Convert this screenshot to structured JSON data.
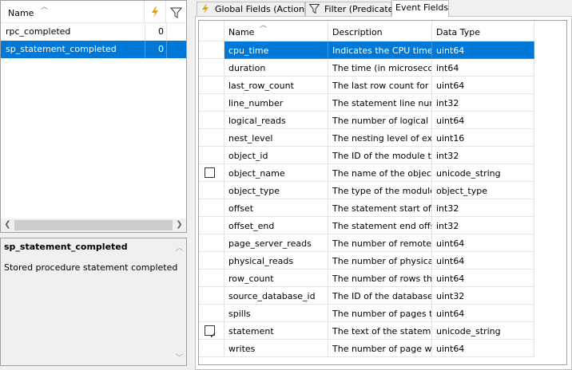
{
  "left_list": {
    "header_name": "Name",
    "rows": [
      {
        "name": "rpc_completed",
        "count": "0"
      },
      {
        "name": "sp_statement_completed",
        "count": "0"
      }
    ]
  },
  "description": {
    "title": "sp_statement_completed",
    "text": "Stored procedure statement completed"
  },
  "tabs": [
    {
      "label": "Global Fields (Actions)"
    },
    {
      "label": "Filter (Predicate)"
    },
    {
      "label": "Event Fields"
    }
  ],
  "grid": {
    "headers": {
      "name": "Name",
      "description": "Description",
      "type": "Data Type"
    },
    "rows": [
      {
        "name": "cpu_time",
        "desc": "Indicates the CPU time (i...",
        "type": "uint64",
        "checkbox": "none"
      },
      {
        "name": "duration",
        "desc": "The time (in microsecon...",
        "type": "int64",
        "checkbox": "none"
      },
      {
        "name": "last_row_count",
        "desc": "The last row count for thi...",
        "type": "uint64",
        "checkbox": "none"
      },
      {
        "name": "line_number",
        "desc": "The statement line numb...",
        "type": "int32",
        "checkbox": "none"
      },
      {
        "name": "logical_reads",
        "desc": "The number of logical pa...",
        "type": "uint64",
        "checkbox": "none"
      },
      {
        "name": "nest_level",
        "desc": "The nesting level of exe...",
        "type": "uint16",
        "checkbox": "none"
      },
      {
        "name": "object_id",
        "desc": "The ID of the module th...",
        "type": "int32",
        "checkbox": "none"
      },
      {
        "name": "object_name",
        "desc": "The name of the object t...",
        "type": "unicode_string",
        "checkbox": "unchecked"
      },
      {
        "name": "object_type",
        "desc": "The type of the module t...",
        "type": "object_type",
        "checkbox": "none"
      },
      {
        "name": "offset",
        "desc": "The statement start offse...",
        "type": "int32",
        "checkbox": "none"
      },
      {
        "name": "offset_end",
        "desc": "The statement end offse...",
        "type": "int32",
        "checkbox": "none"
      },
      {
        "name": "page_server_reads",
        "desc": "The number of remote p...",
        "type": "uint64",
        "checkbox": "none"
      },
      {
        "name": "physical_reads",
        "desc": "The number of physical ...",
        "type": "uint64",
        "checkbox": "none"
      },
      {
        "name": "row_count",
        "desc": "The number of rows that...",
        "type": "uint64",
        "checkbox": "none"
      },
      {
        "name": "source_database_id",
        "desc": "The ID of the database t...",
        "type": "uint32",
        "checkbox": "none"
      },
      {
        "name": "spills",
        "desc": "The number of pages th...",
        "type": "uint64",
        "checkbox": "none"
      },
      {
        "name": "statement",
        "desc": "The text of the statemen...",
        "type": "unicode_string",
        "checkbox": "checked"
      },
      {
        "name": "writes",
        "desc": "The number of page writ...",
        "type": "uint64",
        "checkbox": "none"
      }
    ]
  },
  "colors": {
    "selection": "#0078d7",
    "bolt": "#e8a000"
  },
  "icons": [
    "sort-ascending-icon",
    "lightning-bolt-icon",
    "filter-funnel-icon",
    "scroll-left-icon",
    "scroll-right-icon",
    "scroll-up-icon",
    "scroll-down-icon",
    "checkbox-icon"
  ]
}
